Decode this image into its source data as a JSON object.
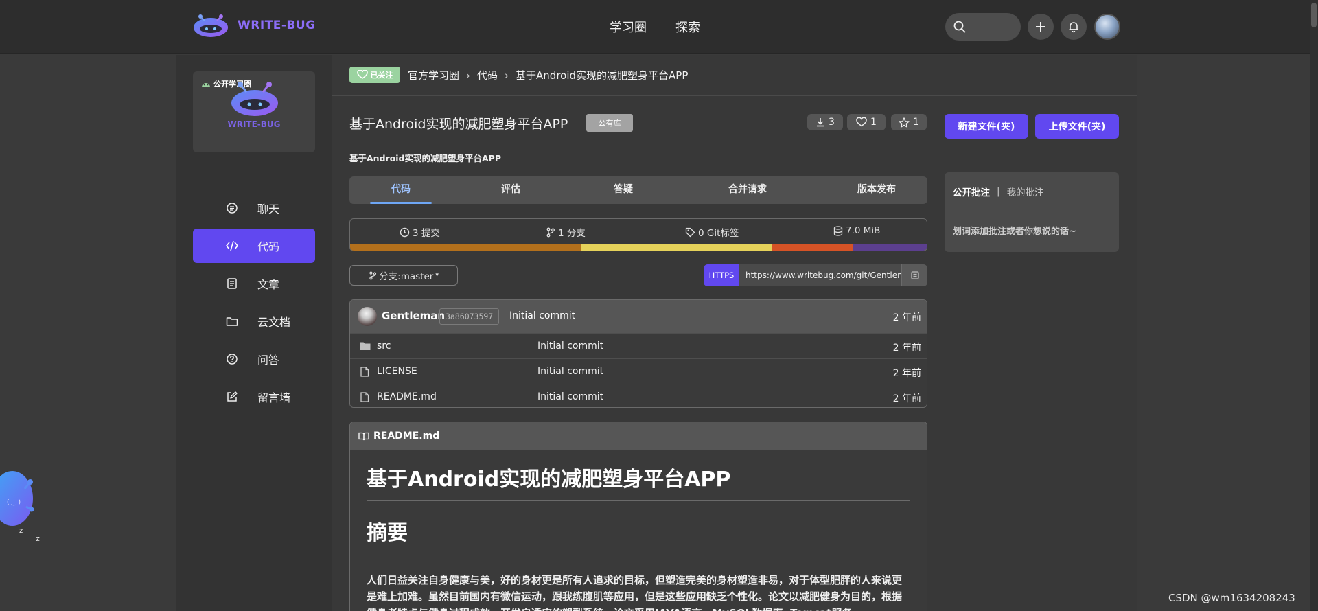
{
  "app": {
    "logo_text": "WRITE-BUG"
  },
  "nav": {
    "items": [
      "学习圈",
      "探索"
    ]
  },
  "sidebar": {
    "group_badge": "公开学习圈",
    "group_name": "WRITE-BUG",
    "items": [
      {
        "label": "聊天",
        "icon": "chat-icon"
      },
      {
        "label": "代码",
        "icon": "code-icon",
        "active": true
      },
      {
        "label": "文章",
        "icon": "article-icon"
      },
      {
        "label": "云文档",
        "icon": "folder-icon"
      },
      {
        "label": "问答",
        "icon": "question-icon"
      },
      {
        "label": "留言墙",
        "icon": "edit-icon"
      }
    ]
  },
  "breadcrumb": {
    "follow_label": "已关注",
    "items": [
      "官方学习圈",
      "代码",
      "基于Android实现的减肥塑身平台APP"
    ]
  },
  "repo": {
    "title": "基于Android实现的减肥塑身平台APP",
    "visibility": "公有库",
    "description": "基于Android实现的减肥塑身平台APP",
    "downloads": "3",
    "likes": "1",
    "stars": "1"
  },
  "actions": {
    "new_file": "新建文件(夹)",
    "upload_file": "上传文件(夹)"
  },
  "tabs": [
    "代码",
    "评估",
    "答疑",
    "合并请求",
    "版本发布"
  ],
  "stats": {
    "commits": "3 提交",
    "branches": "1 分支",
    "tags": "0 Git标签",
    "size": "7.0 MiB",
    "lang_colors": [
      "#b3701c",
      "#e6d25a",
      "#d65326",
      "#5c3f8f"
    ],
    "lang_shares": [
      0.4,
      0.33,
      0.14,
      0.13
    ]
  },
  "branch": {
    "label": "分支:master"
  },
  "clone": {
    "protocol": "HTTPS",
    "url": "https://www.writebug.com/git/Gentleman/xxx.git"
  },
  "latest_commit": {
    "author": "Gentleman",
    "hash": "3a86073597",
    "message": "Initial commit",
    "time": "2 年前"
  },
  "files": [
    {
      "name": "src",
      "type": "folder",
      "message": "Initial commit",
      "time": "2 年前"
    },
    {
      "name": "LICENSE",
      "type": "file",
      "message": "Initial commit",
      "time": "2 年前"
    },
    {
      "name": "README.md",
      "type": "file",
      "message": "Initial commit",
      "time": "2 年前"
    }
  ],
  "readme": {
    "file_name": "README.md",
    "h1": "基于Android实现的减肥塑身平台APP",
    "h2": "摘要",
    "paragraph": "人们日益关注自身健康与美，好的身材更是所有人追求的目标，但塑造完美的身材塑造非易，对于体型肥胖的人来说更是难上加难。虽然目前国内有微信运动，跟我练腹肌等应用，但是这些应用缺乏个性化。论文以减肥健身为目的，根据健身者特点与健身过程成效，开发自适应的塑型系统。论文采用JAVA语言，MySQL数据库, Tomcat服务"
  },
  "annotations": {
    "tab_public": "公开批注",
    "separator": "|",
    "tab_mine": "我的批注",
    "hint": "划词添加批注或者你想说的话~"
  },
  "watermark": "CSDN @wm1634208243"
}
